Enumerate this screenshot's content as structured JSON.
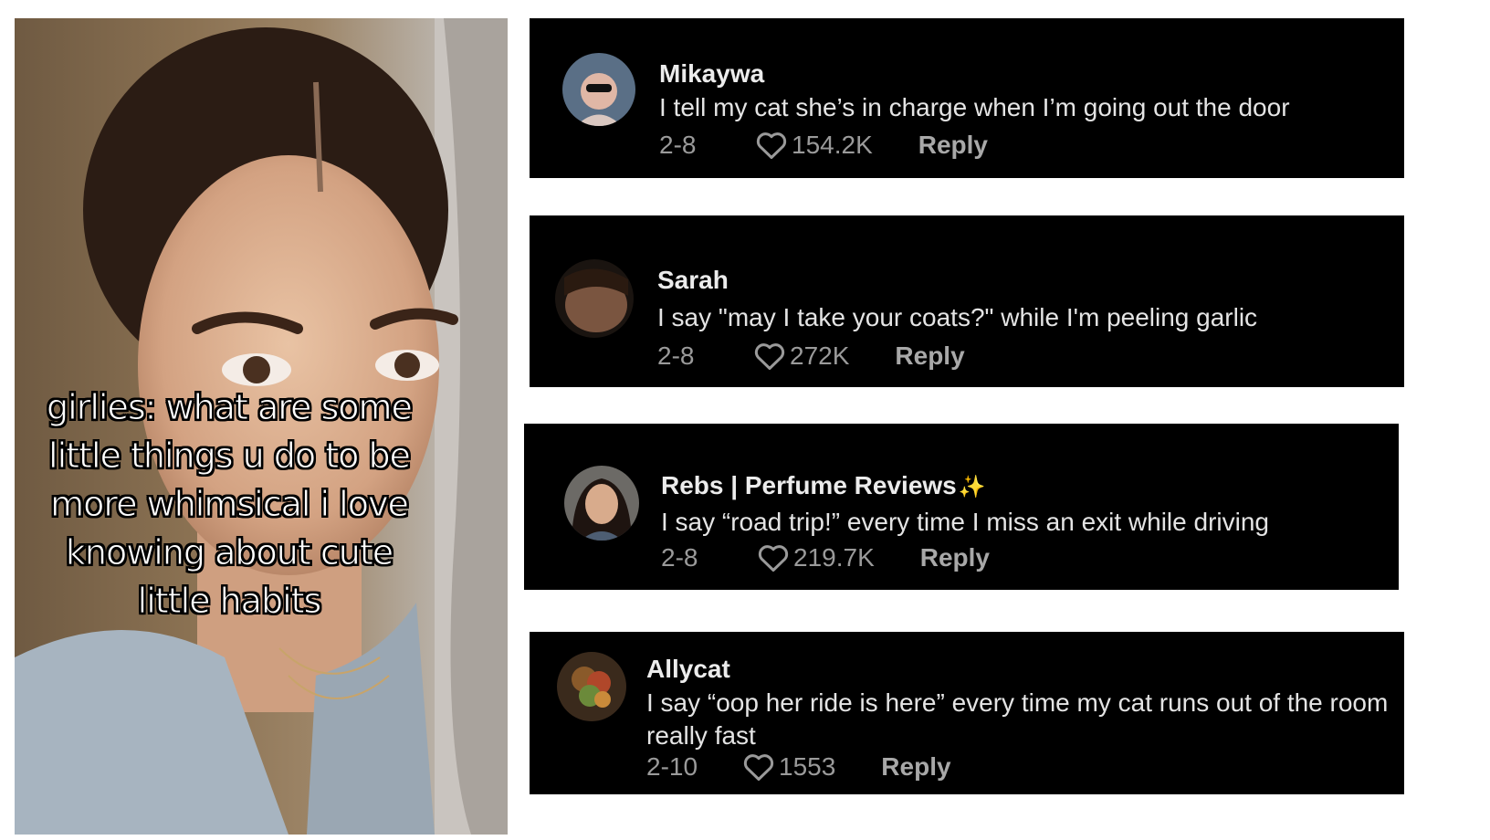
{
  "video": {
    "caption": "girlies: what are some little things u do to be more whimsical i love knowing about cute little habits"
  },
  "comments": [
    {
      "username": "Mikaywa",
      "text": "I tell my cat she’s in charge when I’m going out the door",
      "date": "2-8",
      "likes": "154.2K",
      "reply_label": "Reply"
    },
    {
      "username": "Sarah",
      "text": "I say \"may I take your coats?\" while I'm peeling garlic",
      "date": "2-8",
      "likes": "272K",
      "reply_label": "Reply"
    },
    {
      "username": "Rebs | Perfume Reviews",
      "username_emoji": "✨",
      "text": "I say “road trip!” every time I miss an exit while driving",
      "date": "2-8",
      "likes": "219.7K",
      "reply_label": "Reply"
    },
    {
      "username": "Allycat",
      "text": "I say “oop her ride is here” every time my cat runs out of the room really fast",
      "date": "2-10",
      "likes": "1553",
      "reply_label": "Reply"
    }
  ],
  "icons": {
    "like": "heart-outline-icon",
    "sparkle": "sparkles-emoji"
  },
  "colors": {
    "card_background": "#000000",
    "text_primary": "#ececec",
    "text_secondary": "#9a9a9a",
    "sparkle": "#f7c948"
  }
}
